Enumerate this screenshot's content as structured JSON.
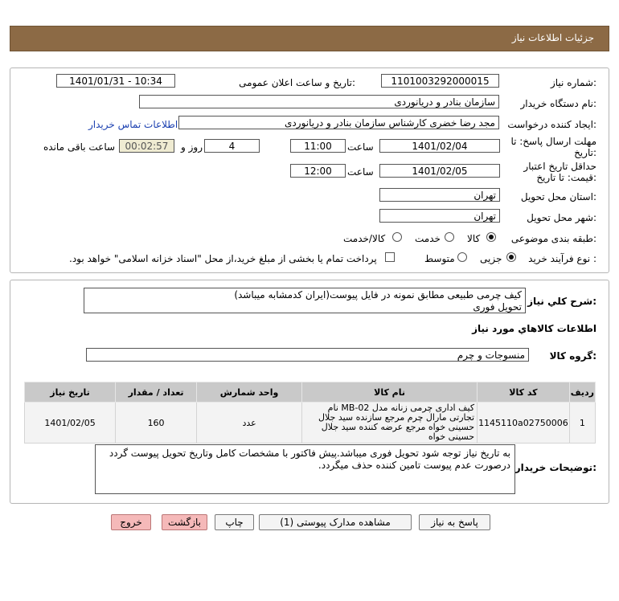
{
  "header": {
    "title": "جزئیات اطلاعات نیاز"
  },
  "form": {
    "need_number_label": "شماره نیاز:",
    "need_number": "1101003292000015",
    "announce_label": "تاریخ و ساعت اعلان عمومی:",
    "announce_value": "1401/01/31 - 10:34",
    "buyer_org_label": "نام دستگاه خریدار:",
    "buyer_org": "سازمان بنادر و دریانوردی",
    "creator_label": "ایجاد کننده درخواست:",
    "creator": "مجد رضا خضری کارشناس سازمان بنادر و دریانوردی",
    "contact_link": "اطلاعات تماس خریدار",
    "deadline_label_1": "مهلت ارسال پاسخ: تا",
    "deadline_label_2": "تاریخ:",
    "deadline_date": "1401/02/04",
    "time_label": "ساعت",
    "deadline_time": "11:00",
    "days_value": "4",
    "days_label": "روز و",
    "remaining_time": "00:02:57",
    "remaining_label": "ساعت باقی مانده",
    "validity_label_1": "حداقل تاریخ اعتبار",
    "validity_label_2": "قیمت: تا تاریخ:",
    "validity_date": "1401/02/05",
    "validity_time": "12:00",
    "province_label": "استان محل تحویل:",
    "province": "تهران",
    "city_label": "شهر محل تحویل:",
    "city": "تهران",
    "category_label": "طبقه بندی موضوعی:",
    "category_options": [
      "کالا",
      "خدمت",
      "کالا/خدمت"
    ],
    "category_selected": "کالا",
    "process_label": "نوع فرآیند خرید :",
    "process_options": [
      "جزیی",
      "متوسط"
    ],
    "process_selected": "جزیی",
    "payment_note": "پرداخت تمام یا بخشی از مبلغ خرید،از محل \"اسناد خزانه اسلامی\" خواهد بود."
  },
  "details": {
    "summary_label": "شرح کلي نياز:",
    "summary_line1": "کیف چرمی طبیعی مطابق نمونه در فایل پیوست(ایران کدمشابه میباشد)",
    "summary_line2": "تحویل فوری",
    "goods_info_title": "اطلاعات کالاهاي مورد نياز",
    "goods_group_label": "گروه کالا:",
    "goods_group": "منسوجات و چرم",
    "table": {
      "headers": [
        "ردیف",
        "کد کالا",
        "نام کالا",
        "واحد شمارش",
        "تعداد / مقدار",
        "تاریخ نیاز"
      ],
      "rows": [
        {
          "row": "1",
          "code": "1145110a02750006",
          "name": "کیف اداری چرمی زنانه مدل MB-02 نام تجارتی مارال چرم مرجع سازنده سید جلال حسینی خواه مرجع عرضه کننده سید جلال حسینی خواه",
          "unit": "عدد",
          "qty": "160",
          "date": "1401/02/05"
        }
      ]
    },
    "buyer_notes_label": "توضیحات خریدار:",
    "buyer_notes": "به تاریخ نیاز توجه شود تحویل فوری میباشد.پیش فاکتور با مشخصات کامل وتاریخ تحویل پیوست گردد درصورت عدم پیوست تامین کننده حذف میگردد."
  },
  "buttons": {
    "reply": "پاسخ به نیاز",
    "attachments": "مشاهده مدارک پیوستی (1)",
    "print": "چاپ",
    "back": "بازگشت",
    "exit": "خروج"
  },
  "colors": {
    "header": "#8c6a45",
    "exit_button": "#f5b9b9",
    "link": "#1a3fb0"
  }
}
